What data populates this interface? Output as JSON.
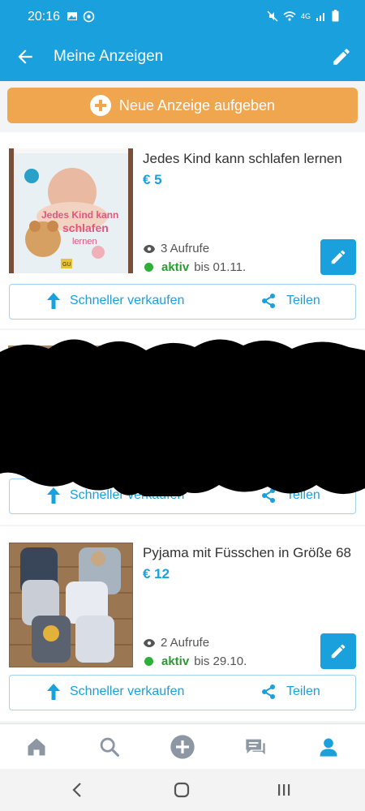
{
  "status_bar": {
    "time": "20:16",
    "network": "4G"
  },
  "app_bar": {
    "title": "Meine Anzeigen"
  },
  "new_ad_button": {
    "label": "Neue Anzeige aufgeben"
  },
  "listings": [
    {
      "title": "Jedes Kind kann schlafen lernen",
      "price": "€ 5",
      "views": "3 Aufrufe",
      "status": "aktiv",
      "until": "bis 01.11.",
      "cover_title_line1": "Jedes Kind kann",
      "cover_title_line2": "schlafen",
      "cover_title_line3": "lernen",
      "cover_publisher": "GU"
    },
    {
      "title": "",
      "price": "",
      "views": "",
      "status": "",
      "until": ""
    },
    {
      "title": "Pyjama mit Füsschen in Größe 68",
      "price": "€ 12",
      "views": "2 Aufrufe",
      "status": "aktiv",
      "until": "bis 29.10."
    }
  ],
  "actions": {
    "sell_faster": "Schneller verkaufen",
    "share": "Teilen"
  },
  "bottom_nav": [
    "home-icon",
    "search-icon",
    "add-icon",
    "messages-icon",
    "profile-icon"
  ],
  "colors": {
    "primary": "#1aa0dc",
    "accent": "#f0a64f",
    "active": "#2fae3a"
  }
}
